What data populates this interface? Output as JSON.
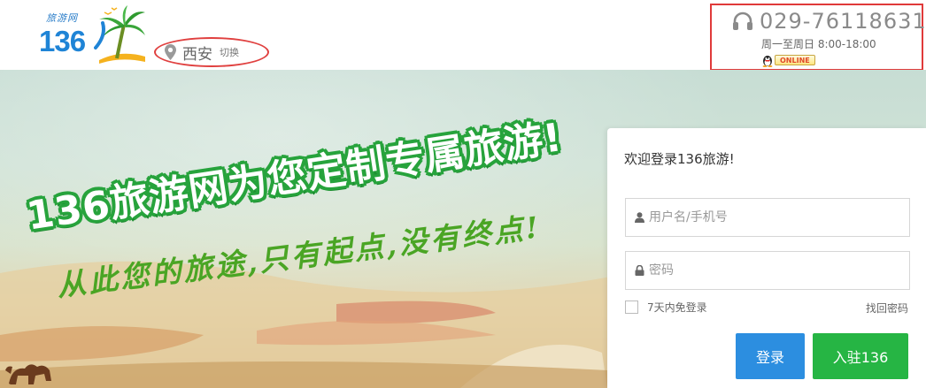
{
  "header": {
    "logo": {
      "small_text": "旅游网",
      "number": "136"
    },
    "city": {
      "name": "西安",
      "switch_label": "切换"
    },
    "contact": {
      "phone": "029-76118631",
      "hours": "周一至周日 8:00-18:00",
      "qq_badge": "ONLINE"
    }
  },
  "banner": {
    "headline": "136旅游网为您定制专属旅游!",
    "slogan": "从此您的旅途,只有起点,没有终点!"
  },
  "login": {
    "title": "欢迎登录136旅游!",
    "username_placeholder": "用户名/手机号",
    "password_placeholder": "密码",
    "remember_label": "7天内免登录",
    "forgot_label": "找回密码",
    "login_button": "登录",
    "join_button": "入驻136"
  },
  "colors": {
    "brand_blue": "#1f84d6",
    "login_blue": "#2c8ee0",
    "join_green": "#26b544",
    "highlight_red": "#e03a3a",
    "headline_green": "#27a33c"
  },
  "icons": {
    "city": "map-pin-icon",
    "phone": "headset-icon",
    "qq": "qq-penguin-icon",
    "username": "user-icon",
    "password": "lock-icon"
  }
}
